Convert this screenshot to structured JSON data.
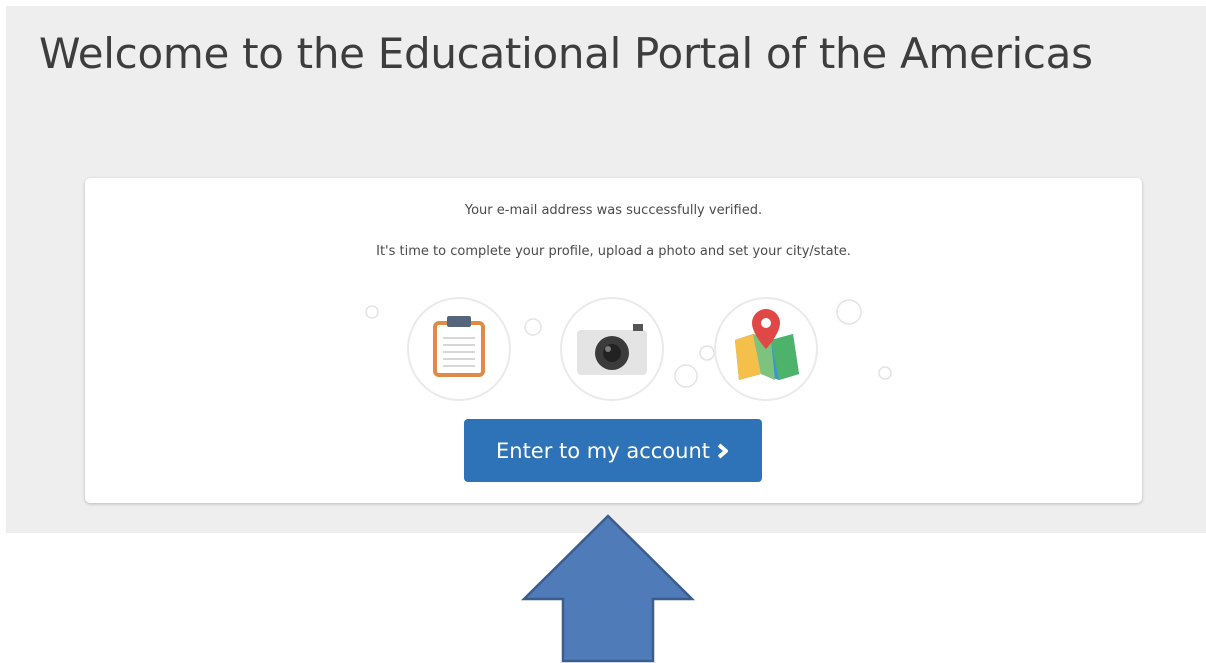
{
  "header": {
    "title": "Welcome to the Educational Portal of the Americas"
  },
  "card": {
    "line1": "Your e-mail address was successfully verified.",
    "line2": "It's time to complete your profile, upload a photo and set your city/state.",
    "icons": [
      "clipboard-icon",
      "camera-icon",
      "map-pin-icon"
    ],
    "button_label": "Enter to my account"
  },
  "colors": {
    "background": "#eeeeee",
    "card": "#ffffff",
    "button": "#2e72b8",
    "arrow": "#4f7cb9",
    "arrow_border": "#3a5d8e"
  }
}
